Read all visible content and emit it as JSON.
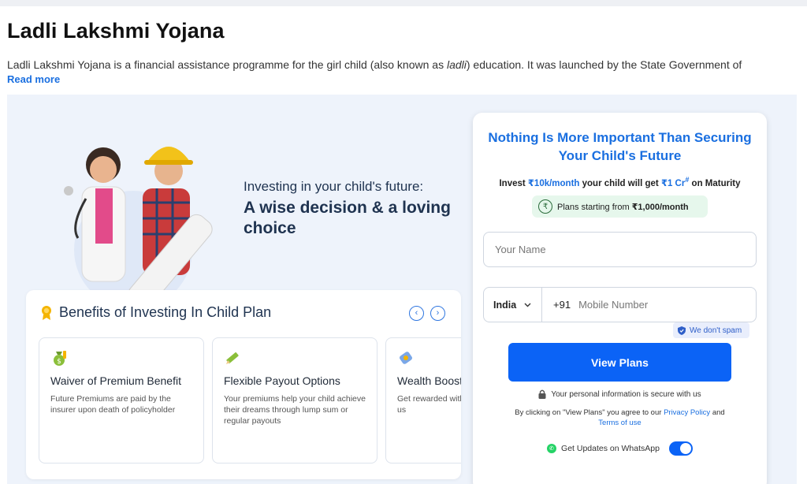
{
  "page": {
    "title": "Ladli Lakshmi Yojana",
    "intro_before": "Ladli Lakshmi Yojana is a financial assistance programme for the girl child (also known as ",
    "intro_italic": "ladli",
    "intro_after": ") education. It was launched by the State Government of",
    "read_more": "Read more"
  },
  "hero": {
    "tagline_line1": "Investing in your child's future:",
    "tagline_line2": "A wise decision & a loving choice"
  },
  "benefits": {
    "title": "Benefits of Investing In Child Plan",
    "prev_icon": "‹",
    "next_icon": "›",
    "tiles": [
      {
        "icon": "money-bag-icon",
        "title": "Waiver of Premium Benefit",
        "desc": "Future Premiums are paid by the insurer upon death of policyholder"
      },
      {
        "icon": "pencil-icon",
        "title": "Flexible Payout Options",
        "desc": "Your premiums help your child achieve their dreams through lump sum or regular payouts"
      },
      {
        "icon": "coin-icon",
        "title": "Wealth Boost",
        "desc": "Get rewarded with Loyalty Bonus for us"
      }
    ]
  },
  "form": {
    "headline": "Nothing Is More Important Than Securing Your Child's Future",
    "invest_prefix": "Invest ",
    "invest_amount": "₹10k/month",
    "invest_mid": " your child will get ",
    "invest_return": "₹1 Cr",
    "invest_sup": "#",
    "invest_suffix": " on Maturity",
    "plans_prefix": "Plans starting from ",
    "plans_amount": "₹1,000/month",
    "rupee_symbol": "₹",
    "name_placeholder": "Your Name",
    "country": "India",
    "dial_code": "+91",
    "mobile_placeholder": "Mobile Number",
    "no_spam": "We don't spam",
    "submit": "View Plans",
    "secure_text": "Your personal information is secure with us",
    "consent_prefix": "By clicking on \"View Plans\" you agree to our ",
    "privacy_link": "Privacy Policy",
    "consent_and": " and ",
    "terms_link": "Terms of use",
    "whatsapp_label": "Get Updates on WhatsApp",
    "whatsapp_enabled": true
  },
  "colors": {
    "accent": "#0b63f6",
    "link": "#1a6fe0",
    "hero_bg": "#eef3fb",
    "pill_bg": "#e6f7ec"
  }
}
